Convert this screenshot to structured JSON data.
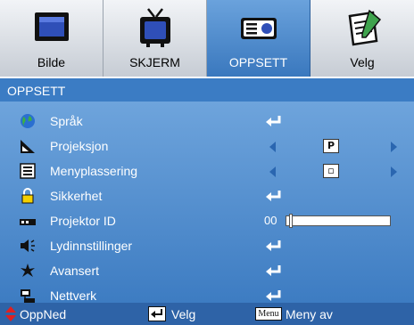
{
  "tabs": [
    {
      "label": "Bilde",
      "icon": "monitor-icon",
      "active": false
    },
    {
      "label": "SKJERM",
      "icon": "tv-icon",
      "active": false
    },
    {
      "label": "OPPSETT",
      "icon": "projector-icon",
      "active": true
    },
    {
      "label": "Velg",
      "icon": "notepad-icon",
      "active": false
    }
  ],
  "header": {
    "title": "OPPSETT"
  },
  "items": [
    {
      "label": "Språk",
      "icon": "globe-icon",
      "control": "enter"
    },
    {
      "label": "Projeksjon",
      "icon": "projection-icon",
      "control": "selector",
      "value": "P"
    },
    {
      "label": "Menyplassering",
      "icon": "menu-position-icon",
      "control": "selector",
      "value": "▫"
    },
    {
      "label": "Sikkerhet",
      "icon": "lock-icon",
      "control": "enter"
    },
    {
      "label": "Projektor ID",
      "icon": "projector-id-icon",
      "control": "slider",
      "value": "00",
      "level": 0
    },
    {
      "label": "Lydinnstillinger",
      "icon": "speaker-icon",
      "control": "enter"
    },
    {
      "label": "Avansert",
      "icon": "advanced-icon",
      "control": "enter"
    },
    {
      "label": "Nettverk",
      "icon": "network-icon",
      "control": "enter"
    }
  ],
  "footer": {
    "navigate_label": "OppNed",
    "navigate_icon": "up-down-arrows-icon",
    "select_label": "Velg",
    "select_icon": "enter-key-icon",
    "menu_key": "Menu",
    "menu_label": "Meny av"
  },
  "colors": {
    "panel_top": "#6ea4dc",
    "panel_bottom": "#3d7cc2",
    "header": "#3b7cc4",
    "footer": "#2e63a7",
    "nav_arrow": "#2a66b0",
    "footer_arrows": "#e02020"
  }
}
